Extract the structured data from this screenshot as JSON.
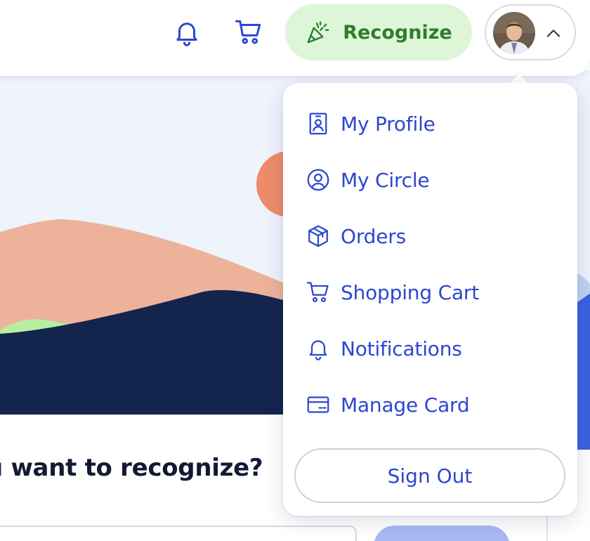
{
  "header": {
    "notifications_icon": "bell-icon",
    "cart_icon": "cart-icon",
    "recognize_label": "Recognize",
    "recognize_icon": "party-popper-icon",
    "profile_toggle_icon": "chevron-up-icon"
  },
  "main": {
    "question": "u want to recognize?"
  },
  "dropdown": {
    "items": [
      {
        "label": "My Profile",
        "icon": "profile-badge-icon"
      },
      {
        "label": "My Circle",
        "icon": "user-circle-icon"
      },
      {
        "label": "Orders",
        "icon": "box-icon"
      },
      {
        "label": "Shopping Cart",
        "icon": "cart-icon"
      },
      {
        "label": "Notifications",
        "icon": "bell-icon"
      },
      {
        "label": "Manage Card",
        "icon": "credit-card-icon"
      }
    ],
    "sign_out_label": "Sign Out"
  },
  "colors": {
    "accent_blue": "#2c47cf",
    "recognize_bg": "#ddf6d8",
    "recognize_text": "#2f7d2b",
    "hero_sky": "#eef3fc",
    "hero_sun": "#ee8b6a",
    "hero_mountain_light": "#edb39a",
    "hero_mountain_dark": "#13244d",
    "hero_hill_green": "#b7efa1"
  }
}
